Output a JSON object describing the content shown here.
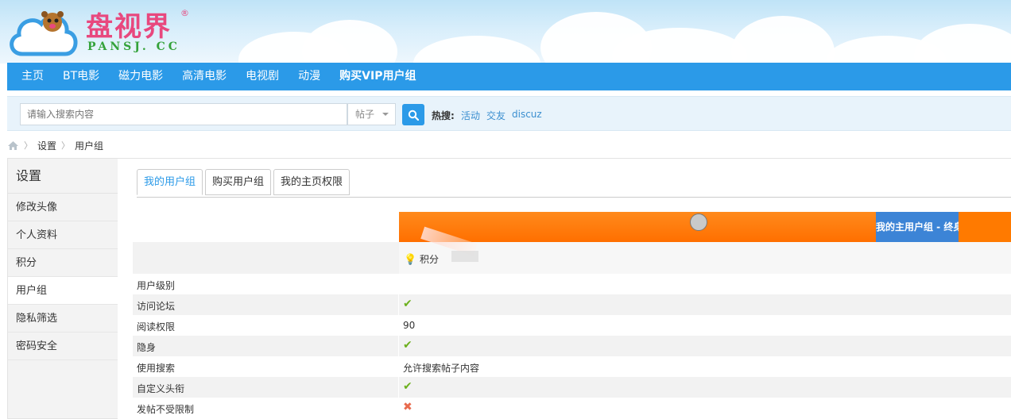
{
  "logo": {
    "main": "盘视界",
    "reg": "®",
    "sub": "PANSJ. CC"
  },
  "nav": {
    "items": [
      {
        "label": "主页",
        "bold": false
      },
      {
        "label": "BT电影",
        "bold": false
      },
      {
        "label": "磁力电影",
        "bold": false
      },
      {
        "label": "高清电影",
        "bold": false
      },
      {
        "label": "电视剧",
        "bold": false
      },
      {
        "label": "动漫",
        "bold": false
      },
      {
        "label": "购买VIP用户组",
        "bold": true
      }
    ]
  },
  "search": {
    "placeholder": "请输入搜索内容",
    "type_selected": "帖子",
    "hot_label": "热搜:",
    "hot_links": [
      "活动",
      "交友",
      "discuz"
    ]
  },
  "breadcrumb": {
    "items": [
      "设置",
      "用户组"
    ]
  },
  "sidebar": {
    "title": "设置",
    "items": [
      "修改头像",
      "个人资料",
      "积分",
      "用户组",
      "隐私筛选",
      "密码安全"
    ],
    "active_index": 3
  },
  "tabs": {
    "items": [
      "我的用户组",
      "购买用户组",
      "我的主页权限"
    ],
    "active_index": 0
  },
  "group": {
    "label": "我的主用户组 - 终身会员",
    "points_label": "积分"
  },
  "permissions": [
    {
      "label": "用户级别",
      "value": "",
      "kind": "text"
    },
    {
      "label": "访问论坛",
      "value": "✔",
      "kind": "check"
    },
    {
      "label": "阅读权限",
      "value": "90",
      "kind": "text"
    },
    {
      "label": "隐身",
      "value": "✔",
      "kind": "check"
    },
    {
      "label": "使用搜索",
      "value": "允许搜索帖子内容",
      "kind": "text"
    },
    {
      "label": "自定义头衔",
      "value": "✔",
      "kind": "check"
    },
    {
      "label": "发帖不受限制",
      "value": "✖",
      "kind": "cross"
    }
  ],
  "colors": {
    "nav": "#2b9ae8",
    "orange": "#ff7a00",
    "group_label": "#3c84d6",
    "check": "#6cb01d",
    "cross": "#e86a4d"
  }
}
